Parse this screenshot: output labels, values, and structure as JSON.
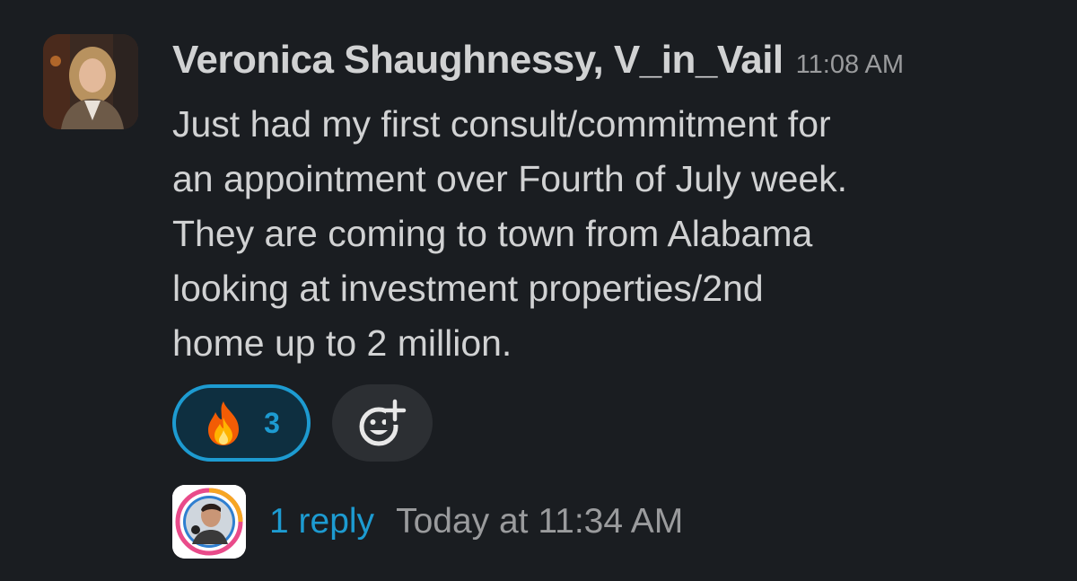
{
  "message": {
    "author": "Veronica Shaughnessy, V_in_Vail",
    "timestamp": "11:08 AM",
    "avatar_icon": "user-photo-avatar",
    "body_lines": [
      "Just had my first consult/commitment for",
      "an appointment over Fourth of July week.",
      "They are coming to town from Alabama",
      "looking at investment properties/2nd",
      "home up to 2 million."
    ]
  },
  "reactions": [
    {
      "emoji": "🔥",
      "icon": "fire-emoji",
      "count": "3",
      "active": true
    }
  ],
  "add_reaction_icon": "add-reaction-icon",
  "thread": {
    "reply_avatar_icon": "replier-photo-avatar",
    "reply_count": "1 reply",
    "last_reply": "Today at 11:34 AM"
  },
  "colors": {
    "background": "#1a1d21",
    "text": "#d1d2d3",
    "muted": "#9a9b9d",
    "accent": "#1d9bd1"
  }
}
